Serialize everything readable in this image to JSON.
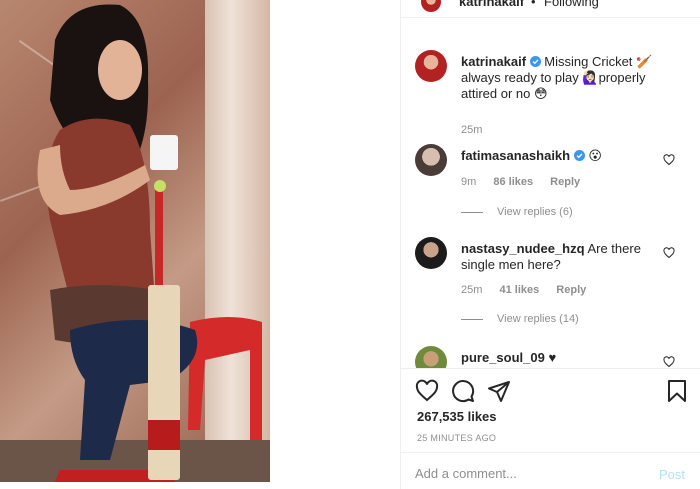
{
  "header": {
    "username": "katrinakaif",
    "separator": "•",
    "follow_status": "Following"
  },
  "caption": {
    "username": "katrinakaif",
    "verified": true,
    "text": "Missing Cricket 🏏 always ready to play 🙋🏻‍♀️properly attired or no 😳",
    "time": "25m"
  },
  "comments": [
    {
      "username": "fatimasanashaikh",
      "verified": true,
      "text": "😮",
      "time": "9m",
      "likes": "86 likes",
      "reply": "Reply",
      "view_replies": "View replies (6)"
    },
    {
      "username": "nastasy_nudee_hzq",
      "verified": false,
      "text": "Are there single men here?",
      "time": "25m",
      "likes": "41 likes",
      "reply": "Reply",
      "view_replies": "View replies (14)"
    },
    {
      "username": "pure_soul_09",
      "verified": false,
      "text": "♥"
    }
  ],
  "actions": {
    "like_icon": "heart-icon",
    "comment_icon": "comment-icon",
    "share_icon": "send-icon",
    "save_icon": "bookmark-icon"
  },
  "likes": "267,535 likes",
  "time_ago": "25 MINUTES AGO",
  "add_comment": {
    "placeholder": "Add a comment...",
    "post_label": "Post"
  },
  "colors": {
    "verified": "#3897f0",
    "muted": "#8e8e8e",
    "post_disabled": "#b2dffc"
  }
}
